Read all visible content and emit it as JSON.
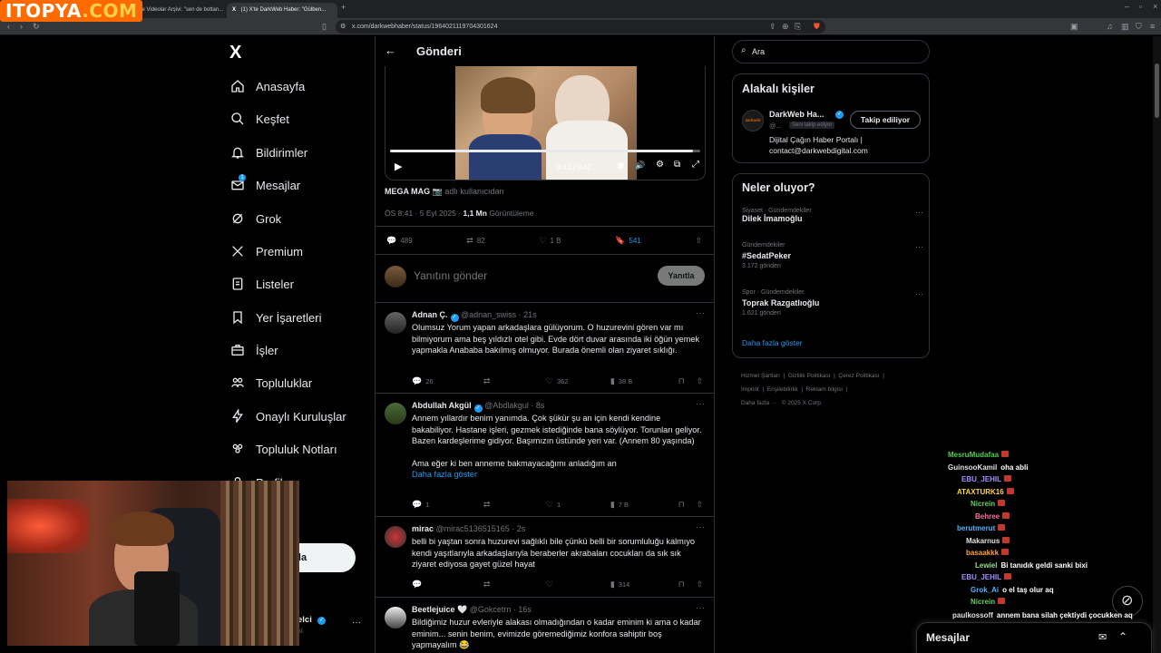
{
  "browser": {
    "tabs": [
      {
        "label": "(1) X'te Videolar Arşivi: \"sen de bottan..."
      },
      {
        "label": "(1) X'te DarkWeb Haber: \"Gülben...",
        "active": true
      }
    ],
    "new_tab": "+",
    "url": "x.com/darkwebhaber/status/1964021119704301624"
  },
  "watermark": {
    "part1": "ITOPYA",
    "part2": ".COM"
  },
  "nav": {
    "logo": "X",
    "items": [
      {
        "label": "Anasayfa",
        "icon": "home-icon"
      },
      {
        "label": "Keşfet",
        "icon": "search-icon"
      },
      {
        "label": "Bildirimler",
        "icon": "bell-icon"
      },
      {
        "label": "Mesajlar",
        "icon": "mail-icon",
        "badge": "1"
      },
      {
        "label": "Grok",
        "icon": "grok-icon"
      },
      {
        "label": "Premium",
        "icon": "x-icon"
      },
      {
        "label": "Listeler",
        "icon": "list-icon"
      },
      {
        "label": "Yer İşaretleri",
        "icon": "bookmark-icon"
      },
      {
        "label": "İşler",
        "icon": "briefcase-icon"
      },
      {
        "label": "Topluluklar",
        "icon": "communities-icon"
      },
      {
        "label": "Onaylı Kuruluşlar",
        "icon": "lightning-icon"
      },
      {
        "label": "Topluluk Notları",
        "icon": "notes-icon"
      },
      {
        "label": "Profil",
        "icon": "profile-icon"
      },
      {
        "label": "zla",
        "icon": "more-icon"
      }
    ],
    "post_button": "ayınla",
    "account_name": "elci",
    "account_handle": "xi",
    "more": "···"
  },
  "header": {
    "back": "←",
    "title": "Gönderi"
  },
  "video": {
    "time": "0:41 / 0:42",
    "progress": 0.976
  },
  "post": {
    "source_name": "MEGA MAG",
    "source_suffix": "adlı kullanıcıdan",
    "time": "ÖS 8:41 · 5 Eyl 2025 ·",
    "views_count": "1,1 Mn",
    "views_label": "Görüntüleme",
    "replies": "489",
    "reposts": "82",
    "likes": "1 B",
    "bookmarks": "541"
  },
  "reply_box": {
    "placeholder": "Yanıtını gönder",
    "button": "Yanıtla"
  },
  "replies": [
    {
      "name": "Adnan Ç.",
      "handle": "@adnan_swiss · 21s",
      "text": "Olumsuz Yorum yapan arkadaşlara gülüyorum. O huzurevini gören var mı bilmiyorum ama beş yıldızlı otel gibi. Evde dört duvar arasında iki öğün yemek yapmakla Anababa bakılmış olmuyor. Burada önemli olan ziyaret sıklığı.",
      "replies": "26",
      "reposts": "",
      "likes": "362",
      "views": "38 B"
    },
    {
      "name": "Abdullah Akgül",
      "handle": "@Abdlakgul · 8s",
      "text": "Annem yıllardır benim yanımda. Çok şükür şu an için kendi kendine bakabiliyor. Hastane işleri, gezmek istediğinde bana söylüyor. Torunları geliyor. Bazen kardeşlerime gidiyor. Başımızın üstünde yeri var. (Annem 80 yaşında)",
      "text2": "Ama eğer ki ben anneme bakmayacağımı anladığım an",
      "more": "Daha fazla göster",
      "replies": "1",
      "reposts": "",
      "likes": "1",
      "views": "7 B"
    },
    {
      "name": "mirac",
      "handle": "@mirac5136515165 · 2s",
      "text": "belli bi yaştan sonra huzurevi sağlıklı bile çünkü belli bir sorumluluğu kalmıyo kendi yaşıtlarıyla arkadaşlarıyla beraberler akrabaları cocukları da sık sık ziyaret ediyosa gayet güzel hayat",
      "replies": "",
      "reposts": "",
      "likes": "",
      "views": "314"
    },
    {
      "name": "Beetlejuice 🤍",
      "handle": "@Gokcetrn · 16s",
      "text": "Bildiğimiz huzur evleriyle alakası olmadığından o kadar eminim ki ama o kadar eminim... senin benim, evimizde göremediğimiz konfora sahiptir boş yapmayalım 😂"
    }
  ],
  "search": {
    "placeholder": "Ara"
  },
  "related": {
    "title": "Alakalı kişiler",
    "name": "DarkWeb Ha...",
    "handle": "@...",
    "follows_you": "Seni takip ediyor",
    "follow_button": "Takip ediliyor",
    "bio": "Dijital Çağın Haber Portalı | contact@darkwebdigital.com",
    "avatar_text": "darkweb"
  },
  "trends": {
    "title": "Neler oluyor?",
    "items": [
      {
        "meta": "Siyaset · Gündemdekiler",
        "name": "Dilek İmamoğlu",
        "count": ""
      },
      {
        "meta": "Gündemdekiler",
        "name": "#SedatPeker",
        "count": "3.172 gönderi"
      },
      {
        "meta": "Spor · Gündemdekiler",
        "name": "Toprak Razgatlıoğlu",
        "count": "1.621 gönderi"
      }
    ],
    "show_more": "Daha fazla göster"
  },
  "footer": {
    "links": [
      "Hizmet Şartları",
      "Gizlilik Politikası",
      "Çerez Politikası",
      "Imprint",
      "Erişilebilirlik",
      "Reklam bilgisi",
      "Daha fazla ···"
    ],
    "copyright": "© 2025 X Corp."
  },
  "messages_drawer": {
    "label": "Mesajlar"
  },
  "chat": [
    {
      "user": "MesruMudafaa",
      "msg": "",
      "color": "#4fd14f"
    },
    {
      "user": "GuinsooKamil",
      "msg": "oha abli",
      "color": "#e0e0e0"
    },
    {
      "user": "EBU_JEHIL",
      "msg": "",
      "color": "#a58bff"
    },
    {
      "user": "ATAXTURK16",
      "msg": "",
      "color": "#ffd23f"
    },
    {
      "user": "Nicrein",
      "msg": "",
      "color": "#5fd15f"
    },
    {
      "user": "Behree",
      "msg": "",
      "color": "#ff6fa5"
    },
    {
      "user": "berutmerut",
      "msg": "",
      "color": "#4fb3ff"
    },
    {
      "user": "Makarnus",
      "msg": "",
      "color": "#e0e0e0"
    },
    {
      "user": "basaakkk",
      "msg": "",
      "color": "#ff9f45"
    },
    {
      "user": "Lewiel",
      "msg": "Bi tanıdık geldi sanki bixi",
      "color": "#8fe08f"
    },
    {
      "user": "EBU_JEHIL",
      "msg": "",
      "color": "#a58bff"
    },
    {
      "user": "Grok_Ai",
      "msg": "o el taş olur aq",
      "color": "#4fb3ff"
    },
    {
      "user": "Nicrein",
      "msg": "",
      "color": "#5fd15f"
    },
    {
      "user": "paulkossoff",
      "msg": "annem bana silah çektiydi çocukken aq",
      "color": "#e0e0e0"
    }
  ]
}
